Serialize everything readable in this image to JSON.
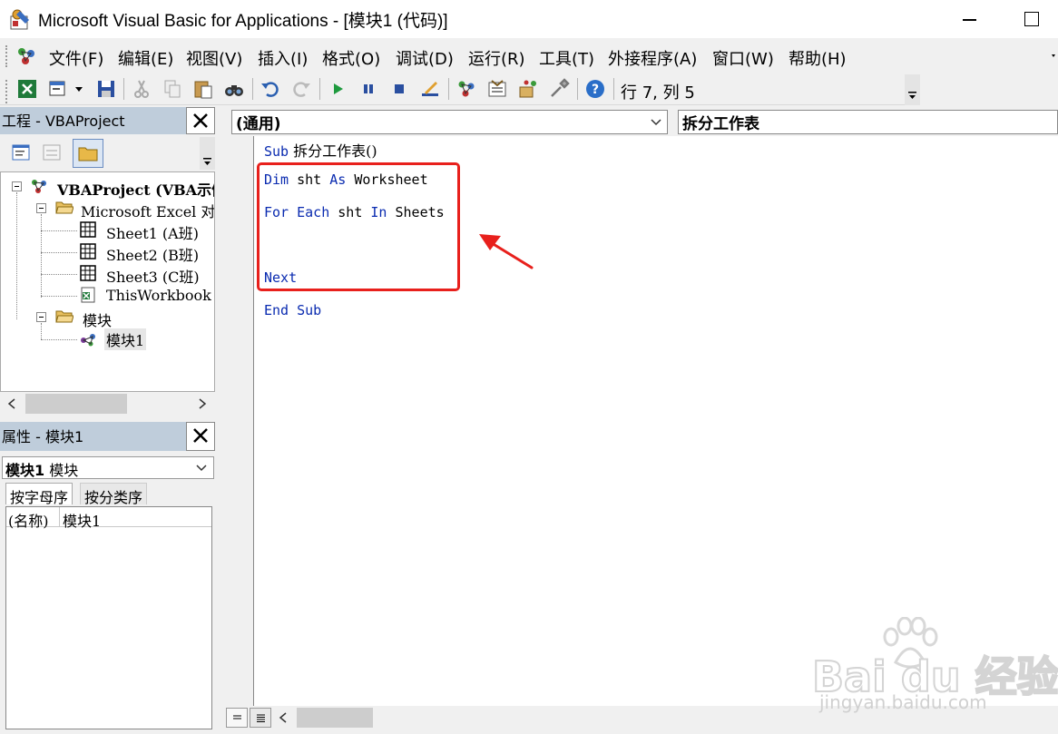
{
  "window": {
    "title": "Microsoft Visual Basic for Applications - [模块1 (代码)]"
  },
  "menu": {
    "items": [
      "文件(F)",
      "编辑(E)",
      "视图(V)",
      "插入(I)",
      "格式(O)",
      "调试(D)",
      "运行(R)",
      "工具(T)",
      "外接程序(A)",
      "窗口(W)",
      "帮助(H)"
    ]
  },
  "toolbar": {
    "row_col": "行 7, 列 5"
  },
  "project": {
    "title": "工程 - VBAProject",
    "tree": {
      "root": "VBAProject (VBA示例",
      "excel_folder": "Microsoft Excel 对",
      "sheet1": "Sheet1 (A班)",
      "sheet2": "Sheet2 (B班)",
      "sheet3": "Sheet3 (C班)",
      "thisworkbook": "ThisWorkbook",
      "modules_folder": "模块",
      "module1": "模块1"
    }
  },
  "properties": {
    "title": "属性 - 模块1",
    "object_name": "模块1",
    "object_type": "模块",
    "tab_alpha": "按字母序",
    "tab_category": "按分类序",
    "prop_name_label": "(名称)",
    "prop_name_value": "模块1"
  },
  "code_window": {
    "object_combo": "(通用)",
    "proc_combo": "拆分工作表",
    "lines": {
      "l1_kw": "Sub",
      "l1_rest": " 拆分工作表()",
      "l2_kw1": "Dim",
      "l2_mid": " sht ",
      "l2_kw2": "As",
      "l2_rest": " Worksheet",
      "l3_kw1": "For",
      "l3_sp1": " ",
      "l3_kw2": "Each",
      "l3_mid": " sht ",
      "l3_kw3": "In",
      "l3_rest": " Sheets",
      "l4_kw": "Next",
      "l5_kw": "End Sub"
    }
  },
  "watermark": {
    "brand": "Bai du 经验",
    "url": "jingyan.baidu.com"
  },
  "colors": {
    "keyword": "#0a2bb0",
    "highlight": "#e8201c",
    "pane_title": "#bfcddb"
  }
}
